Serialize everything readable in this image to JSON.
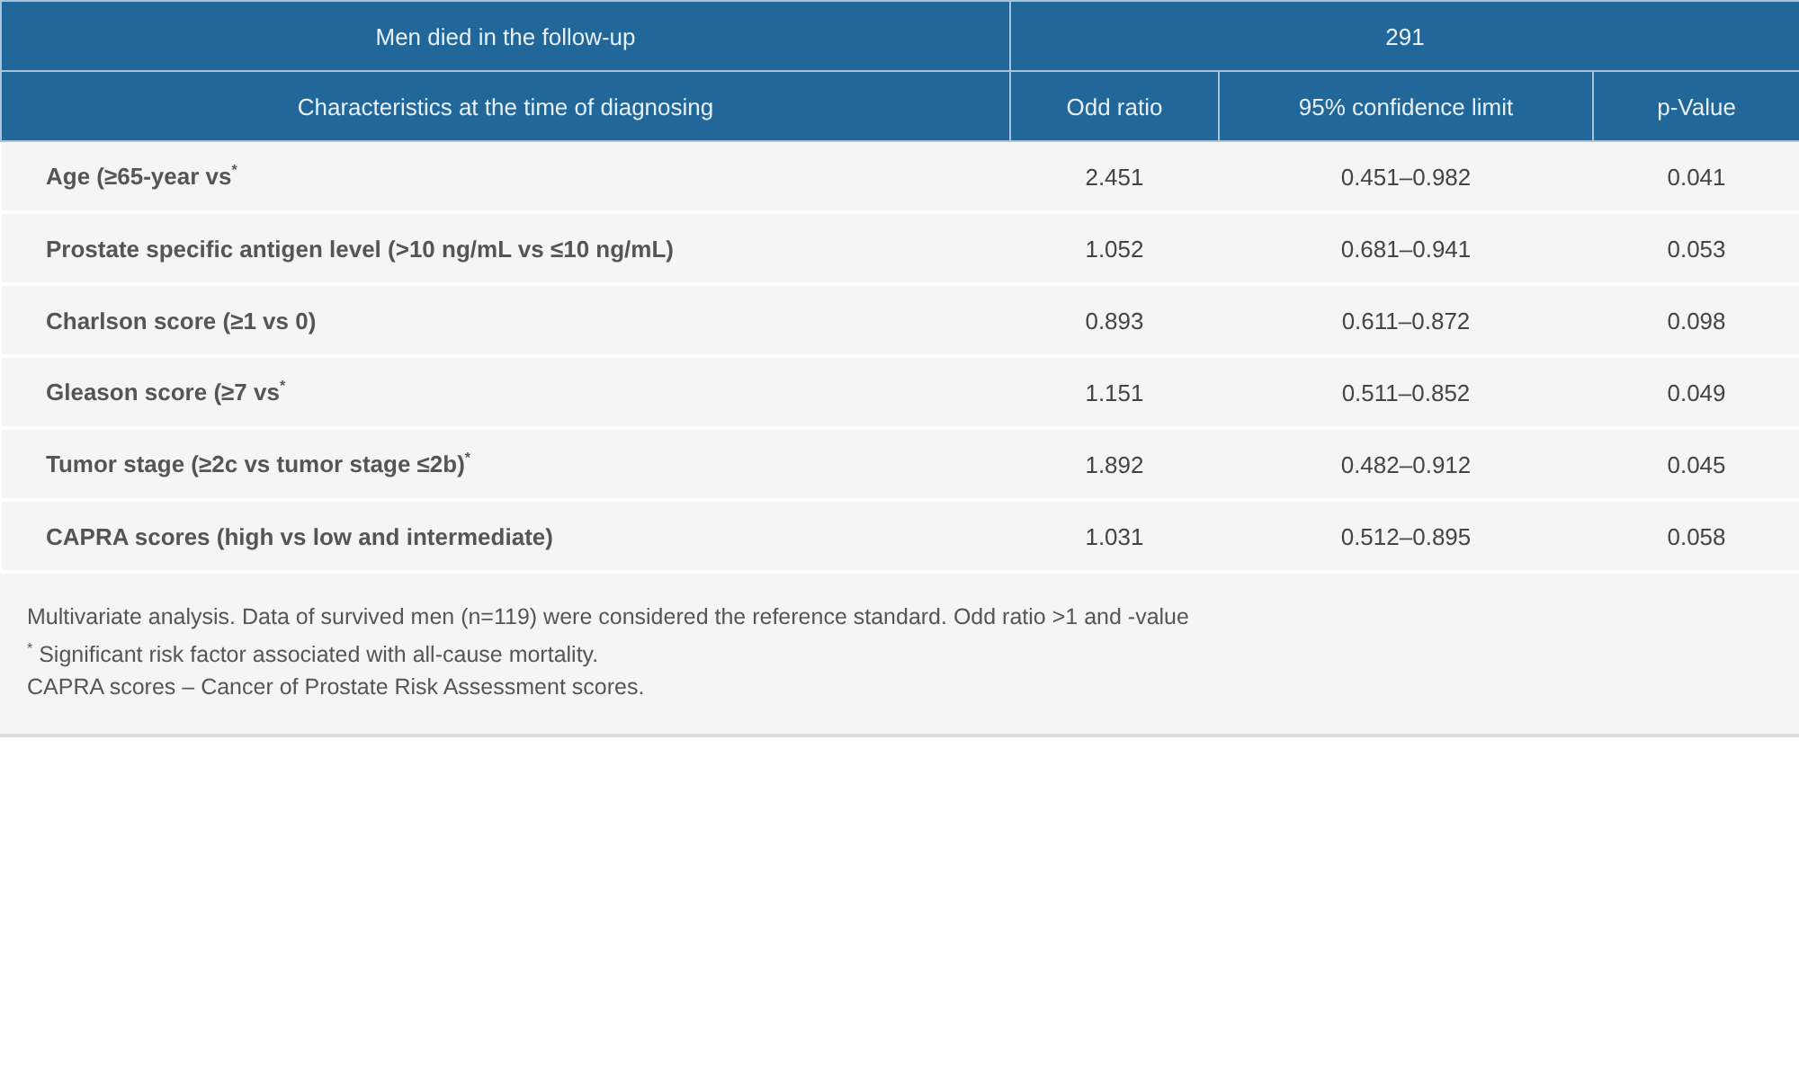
{
  "table": {
    "group_header": {
      "label": "Men died in the follow-up",
      "value": "291"
    },
    "columns": [
      "Characteristics at the time of diagnosing",
      "Odd ratio",
      "95% confidence limit",
      "p-Value"
    ],
    "rows": [
      {
        "characteristic": "Age (≥65-year vs$^{*}$",
        "odd_ratio": "2.451",
        "confidence_limit": "0.451–0.982",
        "p_value": "0.041"
      },
      {
        "characteristic": "Prostate specific antigen level (>10 ng/mL vs ≤10 ng/mL)",
        "odd_ratio": "1.052",
        "confidence_limit": "0.681–0.941",
        "p_value": "0.053"
      },
      {
        "characteristic": "Charlson score (≥1 vs 0)",
        "odd_ratio": "0.893",
        "confidence_limit": "0.611–0.872",
        "p_value": "0.098"
      },
      {
        "characteristic": "Gleason score (≥7 vs$^{*}$",
        "odd_ratio": "1.151",
        "confidence_limit": "0.511–0.852",
        "p_value": "0.049"
      },
      {
        "characteristic": "Tumor stage (≥2c vs tumor stage ≤2b)$^{*}$",
        "odd_ratio": "1.892",
        "confidence_limit": "0.482–0.912",
        "p_value": "0.045"
      },
      {
        "characteristic": "CAPRA scores (high vs low and intermediate)",
        "odd_ratio": "1.031",
        "confidence_limit": "0.512–0.895",
        "p_value": "0.058"
      }
    ]
  },
  "footnotes": [
    "Multivariate analysis. Data of survived men (n=119) were considered the reference standard. Odd ratio >1 and -value",
    "$^{*}$ Significant risk factor associated with all-cause mortality.",
    "CAPRA scores – Cancer of Prostate Risk Assessment scores."
  ]
}
